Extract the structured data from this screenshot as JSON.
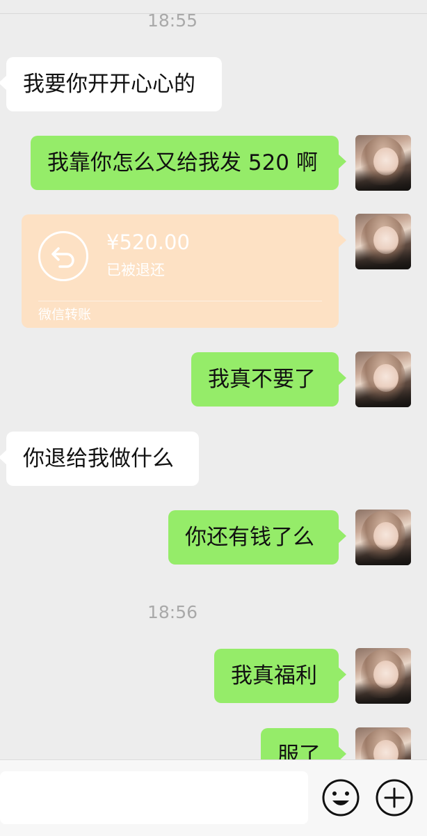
{
  "times": {
    "t1": "18:55",
    "t2": "18:56"
  },
  "messages": [
    {
      "side": "in",
      "text": "我要你开开心心的"
    },
    {
      "side": "out",
      "text": "我靠你怎么又给我发 520 啊"
    },
    {
      "side": "out",
      "text": "我真不要了"
    },
    {
      "side": "in",
      "text": "你退给我做什么"
    },
    {
      "side": "out",
      "text": "你还有钱了么"
    },
    {
      "side": "out",
      "text": "我真福利"
    },
    {
      "side": "out",
      "text": "服了"
    }
  ],
  "transfer": {
    "amount": "¥520.00",
    "status": "已被退还",
    "footer": "微信转账",
    "bg_color": "#fde1c4",
    "icon": "return-arrow-icon"
  },
  "colors": {
    "outgoing": "#95ec69",
    "incoming": "#ffffff",
    "background": "#ededed"
  },
  "input_bar": {
    "icons": [
      "emoji-icon",
      "plus-icon"
    ]
  }
}
